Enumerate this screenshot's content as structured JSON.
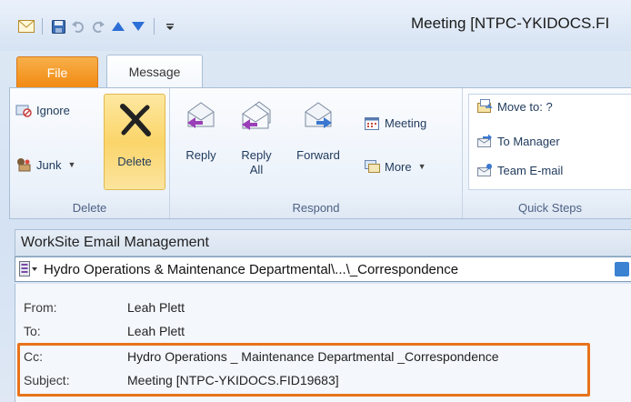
{
  "window": {
    "title": "Meeting [NTPC-YKIDOCS.FI"
  },
  "quick_access": {
    "icons": [
      "mail-icon",
      "save-icon",
      "undo-icon",
      "redo-icon",
      "up-icon",
      "down-icon",
      "customize-icon"
    ]
  },
  "tabs": {
    "file": "File",
    "message": "Message"
  },
  "ribbon": {
    "delete_group": {
      "label": "Delete",
      "ignore": "Ignore",
      "junk": "Junk",
      "delete": "Delete"
    },
    "respond_group": {
      "label": "Respond",
      "reply": "Reply",
      "reply_all_line1": "Reply",
      "reply_all_line2": "All",
      "forward": "Forward",
      "meeting": "Meeting",
      "more": "More"
    },
    "quick_steps_group": {
      "label": "Quick Steps",
      "move_to": "Move to: ?",
      "to_manager": "To Manager",
      "team_email": "Team E-mail"
    }
  },
  "worksite": {
    "title": "WorkSite Email Management",
    "path": "Hydro Operations & Maintenance Departmental\\...\\_Correspondence"
  },
  "message_header": {
    "from_label": "From:",
    "from_value": "Leah Plett",
    "to_label": "To:",
    "to_value": "Leah Plett",
    "cc_label": "Cc:",
    "cc_value": "Hydro Operations _ Maintenance Departmental _Correspondence",
    "subject_label": "Subject:",
    "subject_value": "Meeting [NTPC-YKIDOCS.FID19683]"
  },
  "colors": {
    "accent_orange": "#e8731a",
    "file_tab": "#f28a12",
    "delete_highlight": "#fbd56a"
  }
}
